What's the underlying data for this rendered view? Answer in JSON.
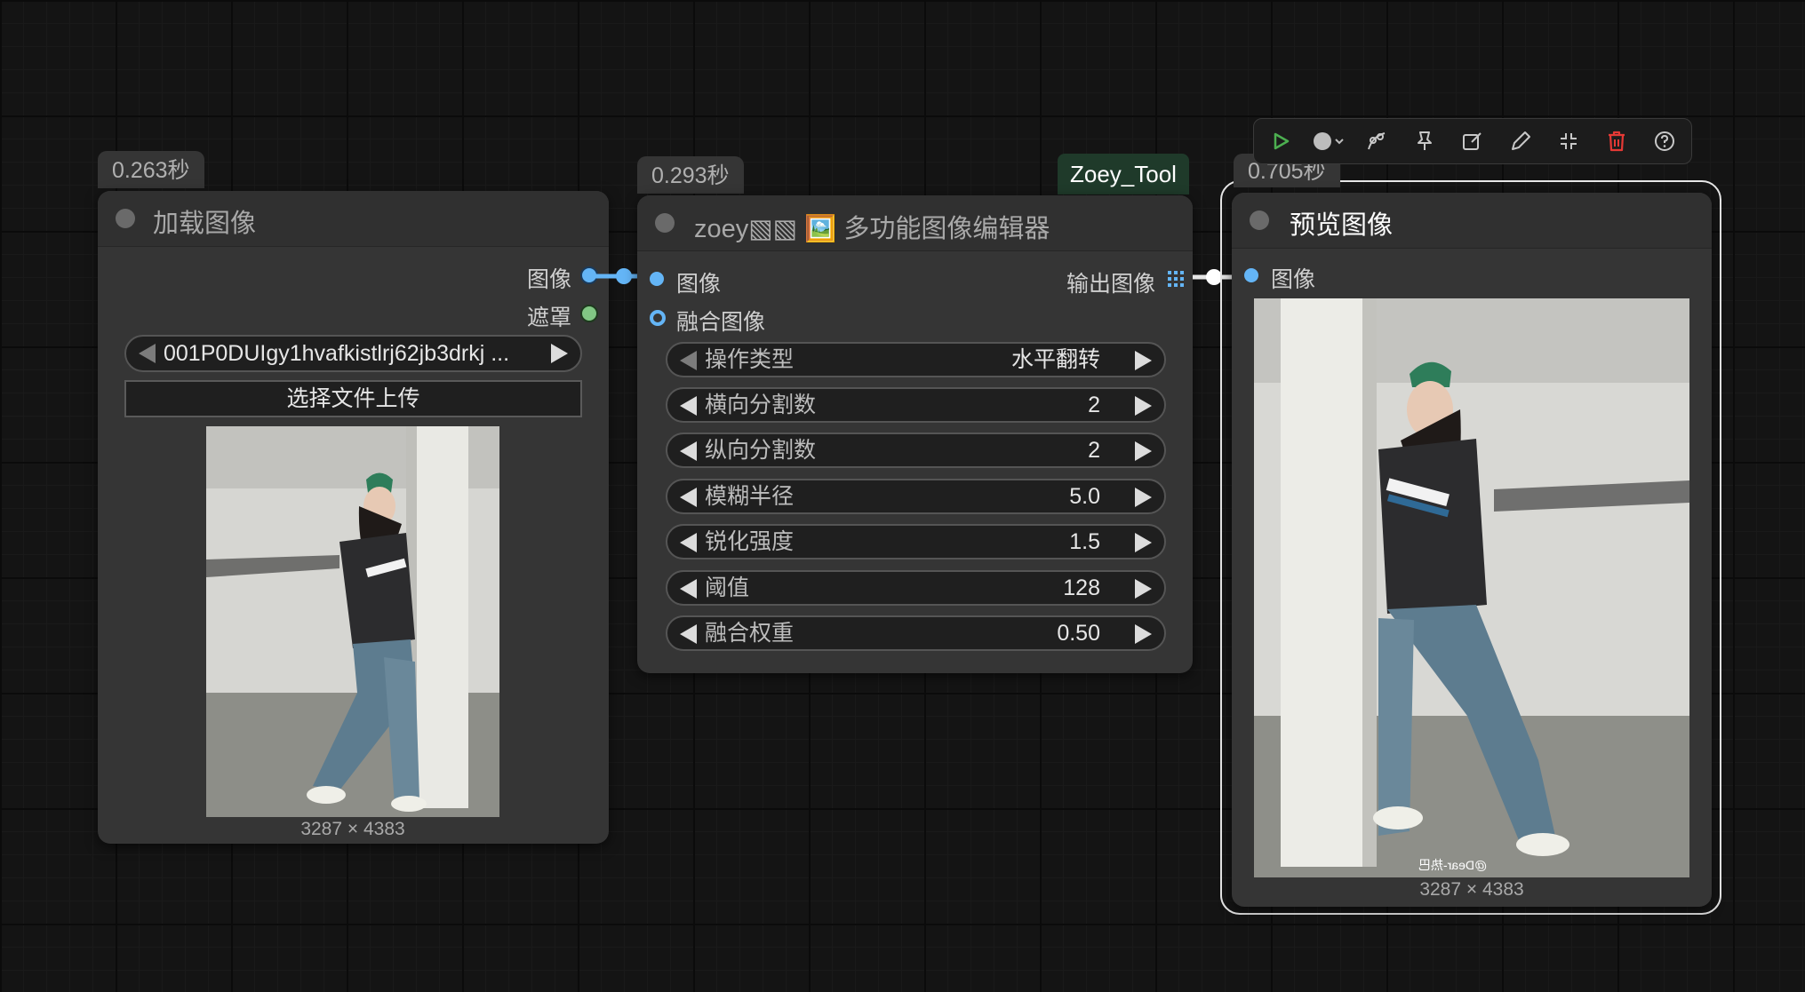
{
  "nodes": {
    "load": {
      "timing": "0.263秒",
      "title": "加载图像",
      "outputs": [
        "图像",
        "遮罩"
      ],
      "file_value": "001P0DUIgy1hvafkistlrj62jb3drkj ...",
      "upload_label": "选择文件上传",
      "image_size": "3287 × 4383"
    },
    "editor": {
      "timing": "0.293秒",
      "badge": "Zoey_Tool",
      "title_prefix": "zoey",
      "title_glyphs": "▧▧",
      "title_emoji": "🖼️",
      "title_main": "多功能图像编辑器",
      "inputs": [
        "图像",
        "融合图像"
      ],
      "output": "输出图像",
      "widgets": [
        {
          "label": "操作类型",
          "value": "水平翻转"
        },
        {
          "label": "横向分割数",
          "value": "2"
        },
        {
          "label": "纵向分割数",
          "value": "2"
        },
        {
          "label": "模糊半径",
          "value": "5.0"
        },
        {
          "label": "锐化强度",
          "value": "1.5"
        },
        {
          "label": "阈值",
          "value": "128"
        },
        {
          "label": "融合权重",
          "value": "0.50"
        }
      ]
    },
    "preview": {
      "timing": "0.705秒",
      "title": "预览图像",
      "input": "图像",
      "image_size": "3287 × 4383",
      "watermark": "@Dear-热巴"
    }
  },
  "toolbar": {
    "icons": [
      "play-icon",
      "color-dot-icon",
      "bypass-icon",
      "pin-icon",
      "edit-icon",
      "pencil-icon",
      "collapse-icon",
      "delete-icon",
      "help-icon"
    ]
  },
  "colors": {
    "image_socket": "#64b5f6",
    "mask_socket": "#81c784",
    "link": "#64b5f6",
    "play": "#4caf50",
    "delete": "#e53935",
    "badge_bg": "#1f3a2a"
  }
}
